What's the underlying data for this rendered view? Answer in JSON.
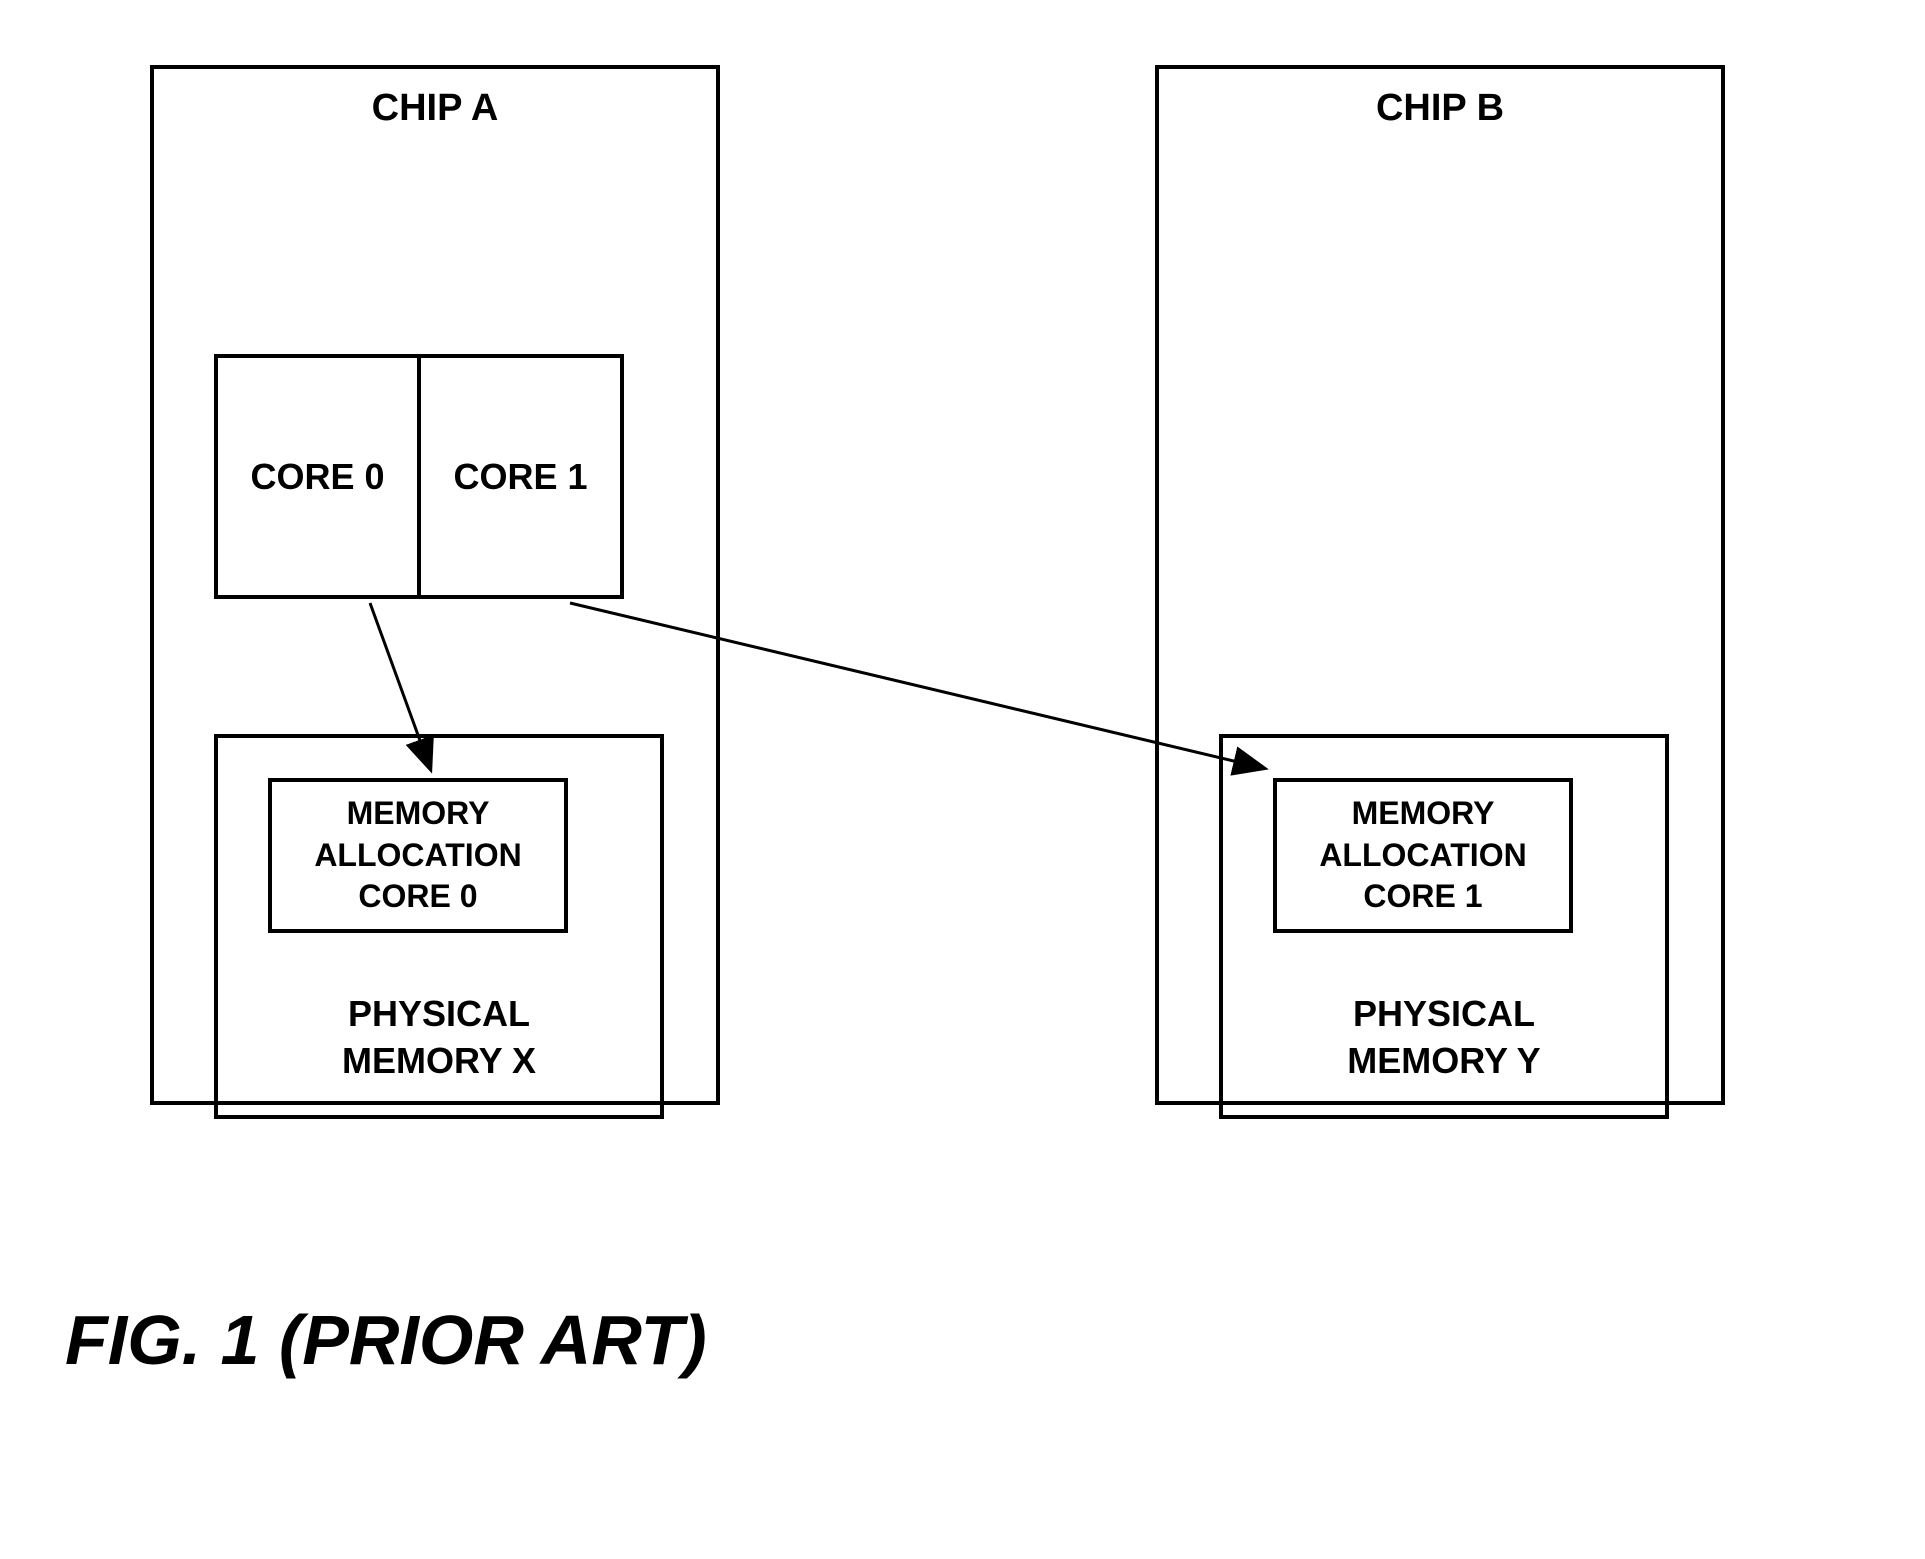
{
  "chipA": {
    "title": "CHIP A",
    "core0": "CORE 0",
    "core1": "CORE 1",
    "allocation": {
      "line1": "MEMORY",
      "line2": "ALLOCATION",
      "line3": "CORE 0"
    },
    "physicalMemory": {
      "line1": "PHYSICAL",
      "line2": "MEMORY X"
    }
  },
  "chipB": {
    "title": "CHIP B",
    "allocation": {
      "line1": "MEMORY",
      "line2": "ALLOCATION",
      "line3": "CORE 1"
    },
    "physicalMemory": {
      "line1": "PHYSICAL",
      "line2": "MEMORY Y"
    }
  },
  "caption": "FIG. 1 (PRIOR ART)"
}
